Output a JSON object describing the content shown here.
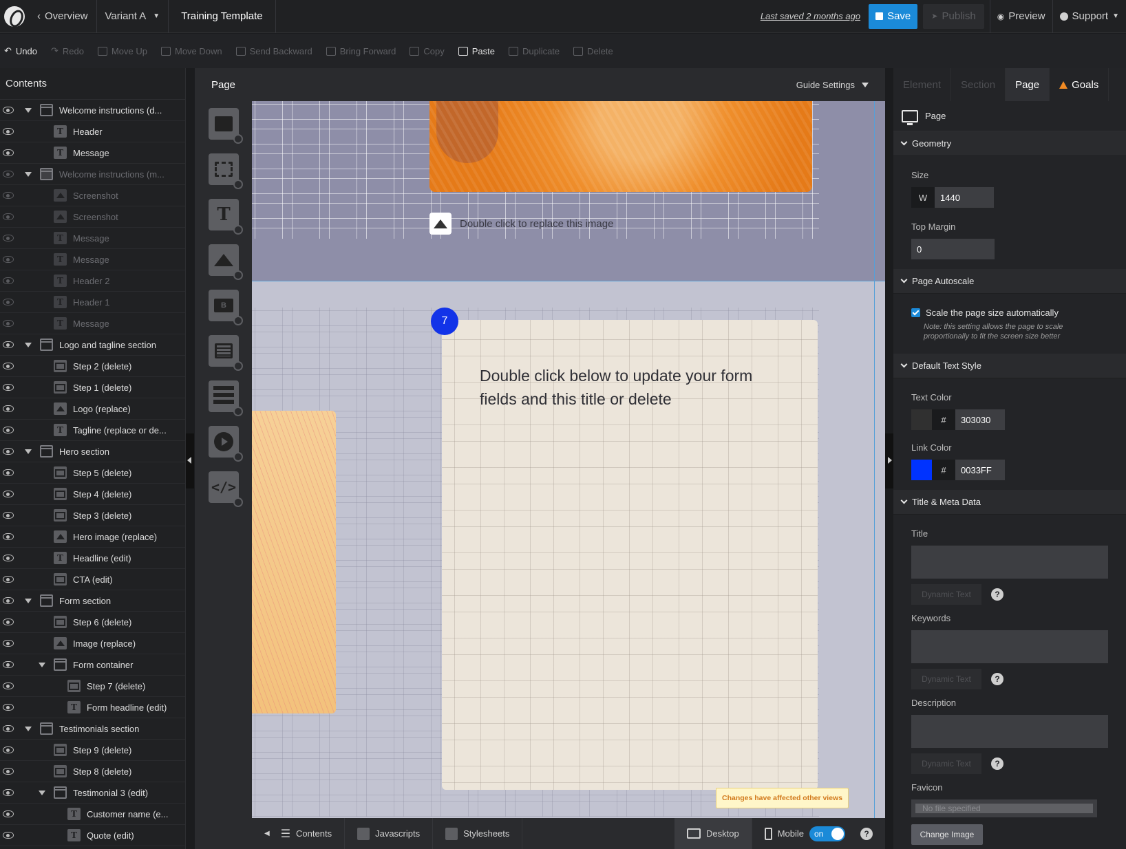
{
  "topbar": {
    "overview": "Overview",
    "variant": "Variant A",
    "title": "Training Template",
    "last_saved": "Last saved  2 months ago",
    "save": "Save",
    "publish": "Publish",
    "preview": "Preview",
    "support": "Support"
  },
  "toolbar": {
    "undo": "Undo",
    "redo": "Redo",
    "move_up": "Move Up",
    "move_down": "Move Down",
    "send_backward": "Send Backward",
    "bring_forward": "Bring Forward",
    "copy": "Copy",
    "paste": "Paste",
    "duplicate": "Duplicate",
    "delete": "Delete"
  },
  "contents": {
    "header": "Contents",
    "items": [
      {
        "label": "Welcome instructions (d...",
        "icon": "section",
        "depth": 0,
        "caret": true,
        "dim": false
      },
      {
        "label": "Header",
        "icon": "text",
        "depth": 1,
        "caret": false,
        "dim": false
      },
      {
        "label": "Message",
        "icon": "text",
        "depth": 1,
        "caret": false,
        "dim": false
      },
      {
        "label": "Welcome instructions (m...",
        "icon": "section",
        "depth": 0,
        "caret": true,
        "dim": true
      },
      {
        "label": "Screenshot",
        "icon": "image",
        "depth": 1,
        "caret": false,
        "dim": true
      },
      {
        "label": "Screenshot",
        "icon": "image",
        "depth": 1,
        "caret": false,
        "dim": true
      },
      {
        "label": "Message",
        "icon": "text",
        "depth": 1,
        "caret": false,
        "dim": true
      },
      {
        "label": "Message",
        "icon": "text",
        "depth": 1,
        "caret": false,
        "dim": true
      },
      {
        "label": "Header 2",
        "icon": "text",
        "depth": 1,
        "caret": false,
        "dim": true
      },
      {
        "label": "Header 1",
        "icon": "text",
        "depth": 1,
        "caret": false,
        "dim": true
      },
      {
        "label": "Message",
        "icon": "text",
        "depth": 1,
        "caret": false,
        "dim": true
      },
      {
        "label": "Logo and tagline section",
        "icon": "section",
        "depth": 0,
        "caret": true,
        "dim": false
      },
      {
        "label": "Step 2 (delete)",
        "icon": "button",
        "depth": 1,
        "caret": false,
        "dim": false
      },
      {
        "label": "Step 1 (delete)",
        "icon": "button",
        "depth": 1,
        "caret": false,
        "dim": false
      },
      {
        "label": "Logo (replace)",
        "icon": "image",
        "depth": 1,
        "caret": false,
        "dim": false
      },
      {
        "label": "Tagline (replace or de...",
        "icon": "text",
        "depth": 1,
        "caret": false,
        "dim": false
      },
      {
        "label": "Hero section",
        "icon": "section",
        "depth": 0,
        "caret": true,
        "dim": false
      },
      {
        "label": "Step 5 (delete)",
        "icon": "button",
        "depth": 1,
        "caret": false,
        "dim": false
      },
      {
        "label": "Step 4 (delete)",
        "icon": "button",
        "depth": 1,
        "caret": false,
        "dim": false
      },
      {
        "label": "Step 3 (delete)",
        "icon": "button",
        "depth": 1,
        "caret": false,
        "dim": false
      },
      {
        "label": "Hero image (replace)",
        "icon": "image",
        "depth": 1,
        "caret": false,
        "dim": false
      },
      {
        "label": "Headline (edit)",
        "icon": "text",
        "depth": 1,
        "caret": false,
        "dim": false
      },
      {
        "label": "CTA (edit)",
        "icon": "button",
        "depth": 1,
        "caret": false,
        "dim": false
      },
      {
        "label": "Form section",
        "icon": "section",
        "depth": 0,
        "caret": true,
        "dim": false
      },
      {
        "label": "Step 6 (delete)",
        "icon": "button",
        "depth": 1,
        "caret": false,
        "dim": false
      },
      {
        "label": "Image (replace)",
        "icon": "image",
        "depth": 1,
        "caret": false,
        "dim": false
      },
      {
        "label": "Form container",
        "icon": "box",
        "depth": 1,
        "caret": true,
        "dim": false
      },
      {
        "label": "Step 7 (delete)",
        "icon": "button",
        "depth": 2,
        "caret": false,
        "dim": false
      },
      {
        "label": "Form headline (edit)",
        "icon": "text",
        "depth": 2,
        "caret": false,
        "dim": false
      },
      {
        "label": "Testimonials section",
        "icon": "section",
        "depth": 0,
        "caret": true,
        "dim": false
      },
      {
        "label": "Step 9 (delete)",
        "icon": "button",
        "depth": 1,
        "caret": false,
        "dim": false
      },
      {
        "label": "Step 8 (delete)",
        "icon": "button",
        "depth": 1,
        "caret": false,
        "dim": false
      },
      {
        "label": "Testimonial 3 (edit)",
        "icon": "box",
        "depth": 1,
        "caret": true,
        "dim": false
      },
      {
        "label": "Customer name (e...",
        "icon": "text",
        "depth": 2,
        "caret": false,
        "dim": false
      },
      {
        "label": "Quote (edit)",
        "icon": "text",
        "depth": 2,
        "caret": false,
        "dim": false
      }
    ]
  },
  "widgets": {
    "tab": "Page",
    "text_glyph": "T",
    "button_glyph": "B",
    "code_glyph": "</>"
  },
  "canvas": {
    "guide_settings": "Guide Settings",
    "replace_image": "Double click to replace this image",
    "form_title": "Double click below to update your form fields and this title or delete",
    "step_badge": "7",
    "tooltip": "Changes have affected other views"
  },
  "bottombar": {
    "contents": "Contents",
    "javascripts": "Javascripts",
    "stylesheets": "Stylesheets",
    "desktop": "Desktop",
    "mobile": "Mobile",
    "toggle": "on",
    "help": "?"
  },
  "properties": {
    "tabs": {
      "element": "Element",
      "section": "Section",
      "page": "Page",
      "goals": "Goals"
    },
    "panel_title": "Page",
    "geometry": {
      "header": "Geometry",
      "size_label": "Size",
      "w_prefix": "W",
      "width_value": "1440",
      "top_margin_label": "Top Margin",
      "top_margin_value": "0"
    },
    "autoscale": {
      "header": "Page Autoscale",
      "checkbox_label": "Scale the page size automatically",
      "note": "Note: this setting allows the page to scale proportionally to fit the screen size better"
    },
    "text_style": {
      "header": "Default Text Style",
      "text_color_label": "Text Color",
      "text_color_value": "303030",
      "text_color_hex": "#303030",
      "link_color_label": "Link Color",
      "link_color_value": "0033FF",
      "link_color_hex": "#0033FF",
      "hash": "#"
    },
    "meta": {
      "header": "Title & Meta Data",
      "title_label": "Title",
      "keywords_label": "Keywords",
      "description_label": "Description",
      "dynamic_text": "Dynamic Text",
      "help": "?",
      "favicon_label": "Favicon",
      "file_placeholder": "No file specified",
      "change_image": "Change Image"
    }
  }
}
